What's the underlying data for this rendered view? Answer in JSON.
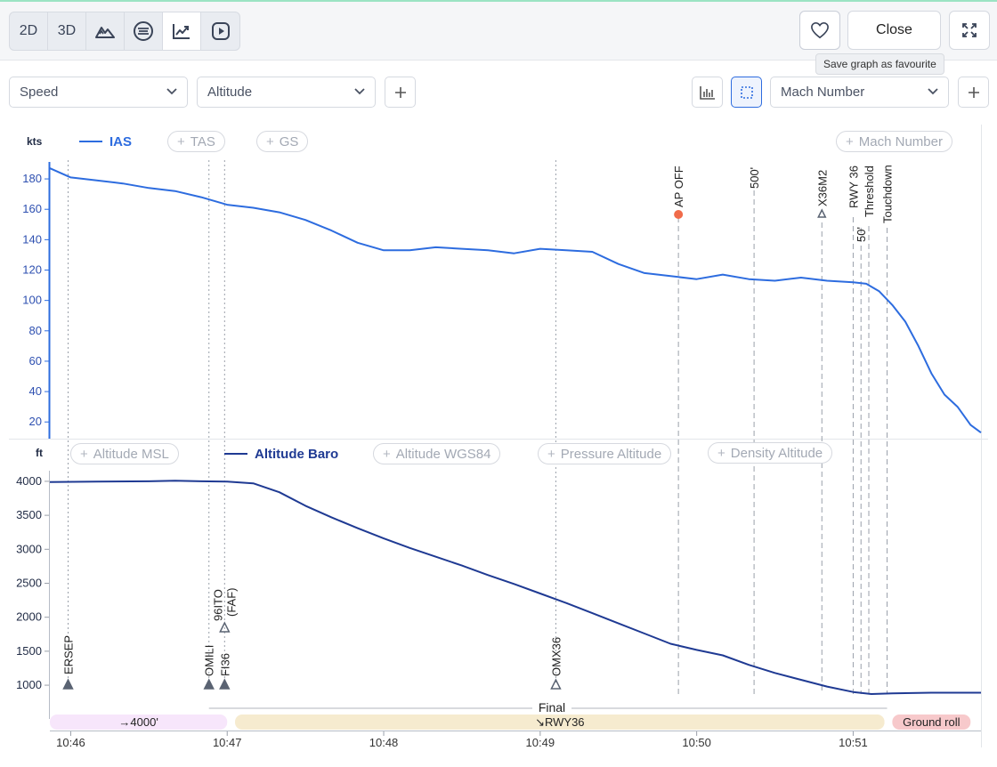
{
  "toolbar": {
    "view_buttons": [
      "2D",
      "3D"
    ],
    "close_label": "Close",
    "favourite_tooltip": "Save graph as favourite"
  },
  "selectors": {
    "left_1": "Speed",
    "left_2": "Altitude",
    "right": "Mach Number"
  },
  "colors": {
    "speed": "#2d6cdf",
    "altitude": "#1f3a93",
    "event_line": "#9aa0aa",
    "ap_off_dot": "#f06b4a",
    "phase_climb": "#f7e6fb",
    "phase_final": "#f6ebcf",
    "phase_ground": "#f7c9cb"
  },
  "speed_panel": {
    "unit": "kts",
    "legend": {
      "active": "IAS",
      "inactive": [
        "TAS",
        "GS"
      ],
      "right": "Mach Number"
    }
  },
  "altitude_panel": {
    "unit": "ft",
    "legend": {
      "inactive_left": "Altitude MSL",
      "active": "Altitude Baro",
      "inactive_right": [
        "Altitude WGS84",
        "Pressure Altitude",
        "Density Altitude"
      ]
    }
  },
  "events": {
    "ap_off": "AP OFF",
    "h500": "500'",
    "x36m2": "X36M2",
    "rwy36": "RWY 36",
    "threshold": "Threshold",
    "h50": "50'",
    "touchdown": "Touchdown",
    "ersep": "ERSEP",
    "omili": "OMILI",
    "fi36": "FI36",
    "faf_1": "96ITO",
    "faf_2": "(FAF)",
    "omx36": "OMX36"
  },
  "phases": {
    "final": "Final",
    "climb": "→4000'",
    "approach": "↘RWY36",
    "ground": "Ground roll"
  },
  "chart_data": [
    {
      "type": "line",
      "ylabel": "kts",
      "x_unit": "time (hh:mm)",
      "x_ticks": [
        "10:46",
        "10:47",
        "10:48",
        "10:49",
        "10:50",
        "10:51"
      ],
      "y_ticks": [
        20,
        40,
        60,
        80,
        100,
        120,
        140,
        160,
        180
      ],
      "xlim": [
        "10:45:52",
        "10:51:49"
      ],
      "ylim": [
        9,
        190
      ],
      "series": [
        {
          "name": "IAS",
          "x": [
            "10:45:52",
            "10:46:00",
            "10:46:10",
            "10:46:20",
            "10:46:30",
            "10:46:40",
            "10:46:50",
            "10:47:00",
            "10:47:10",
            "10:47:20",
            "10:47:30",
            "10:47:40",
            "10:47:50",
            "10:48:00",
            "10:48:10",
            "10:48:20",
            "10:48:30",
            "10:48:40",
            "10:48:50",
            "10:49:00",
            "10:49:10",
            "10:49:20",
            "10:49:30",
            "10:49:40",
            "10:49:50",
            "10:50:00",
            "10:50:10",
            "10:50:20",
            "10:50:30",
            "10:50:40",
            "10:50:50",
            "10:51:00",
            "10:51:05",
            "10:51:10",
            "10:51:15",
            "10:51:20",
            "10:51:25",
            "10:51:30",
            "10:51:35",
            "10:51:40",
            "10:51:45",
            "10:51:49"
          ],
          "values": [
            187,
            181,
            179,
            177,
            174,
            172,
            168,
            163,
            161,
            158,
            153,
            146,
            138,
            133,
            133,
            135,
            134,
            133,
            131,
            134,
            133,
            132,
            124,
            118,
            116,
            114,
            117,
            114,
            113,
            115,
            113,
            112,
            111,
            106,
            97,
            86,
            70,
            52,
            38,
            30,
            18,
            13
          ]
        }
      ]
    },
    {
      "type": "line",
      "ylabel": "ft",
      "x_unit": "time (hh:mm)",
      "x_ticks": [
        "10:46",
        "10:47",
        "10:48",
        "10:49",
        "10:50",
        "10:51"
      ],
      "y_ticks": [
        1000,
        1500,
        2000,
        2500,
        3000,
        3500,
        4000
      ],
      "xlim": [
        "10:45:52",
        "10:51:49"
      ],
      "ylim": [
        870,
        4130
      ],
      "series": [
        {
          "name": "Altitude Baro",
          "x": [
            "10:45:52",
            "10:46:10",
            "10:46:30",
            "10:46:40",
            "10:46:50",
            "10:47:00",
            "10:47:10",
            "10:47:20",
            "10:47:30",
            "10:47:40",
            "10:47:50",
            "10:48:00",
            "10:48:10",
            "10:48:20",
            "10:48:30",
            "10:48:40",
            "10:48:50",
            "10:49:00",
            "10:49:10",
            "10:49:20",
            "10:49:30",
            "10:49:40",
            "10:49:50",
            "10:50:00",
            "10:50:10",
            "10:50:20",
            "10:50:30",
            "10:50:40",
            "10:50:50",
            "10:51:00",
            "10:51:07",
            "10:51:15",
            "10:51:30",
            "10:51:49"
          ],
          "values": [
            3990,
            3995,
            4000,
            4010,
            4000,
            3995,
            3970,
            3840,
            3640,
            3470,
            3310,
            3160,
            3020,
            2890,
            2760,
            2620,
            2490,
            2350,
            2210,
            2060,
            1910,
            1760,
            1610,
            1520,
            1440,
            1300,
            1180,
            1080,
            980,
            900,
            870,
            880,
            890,
            890
          ]
        }
      ]
    }
  ]
}
